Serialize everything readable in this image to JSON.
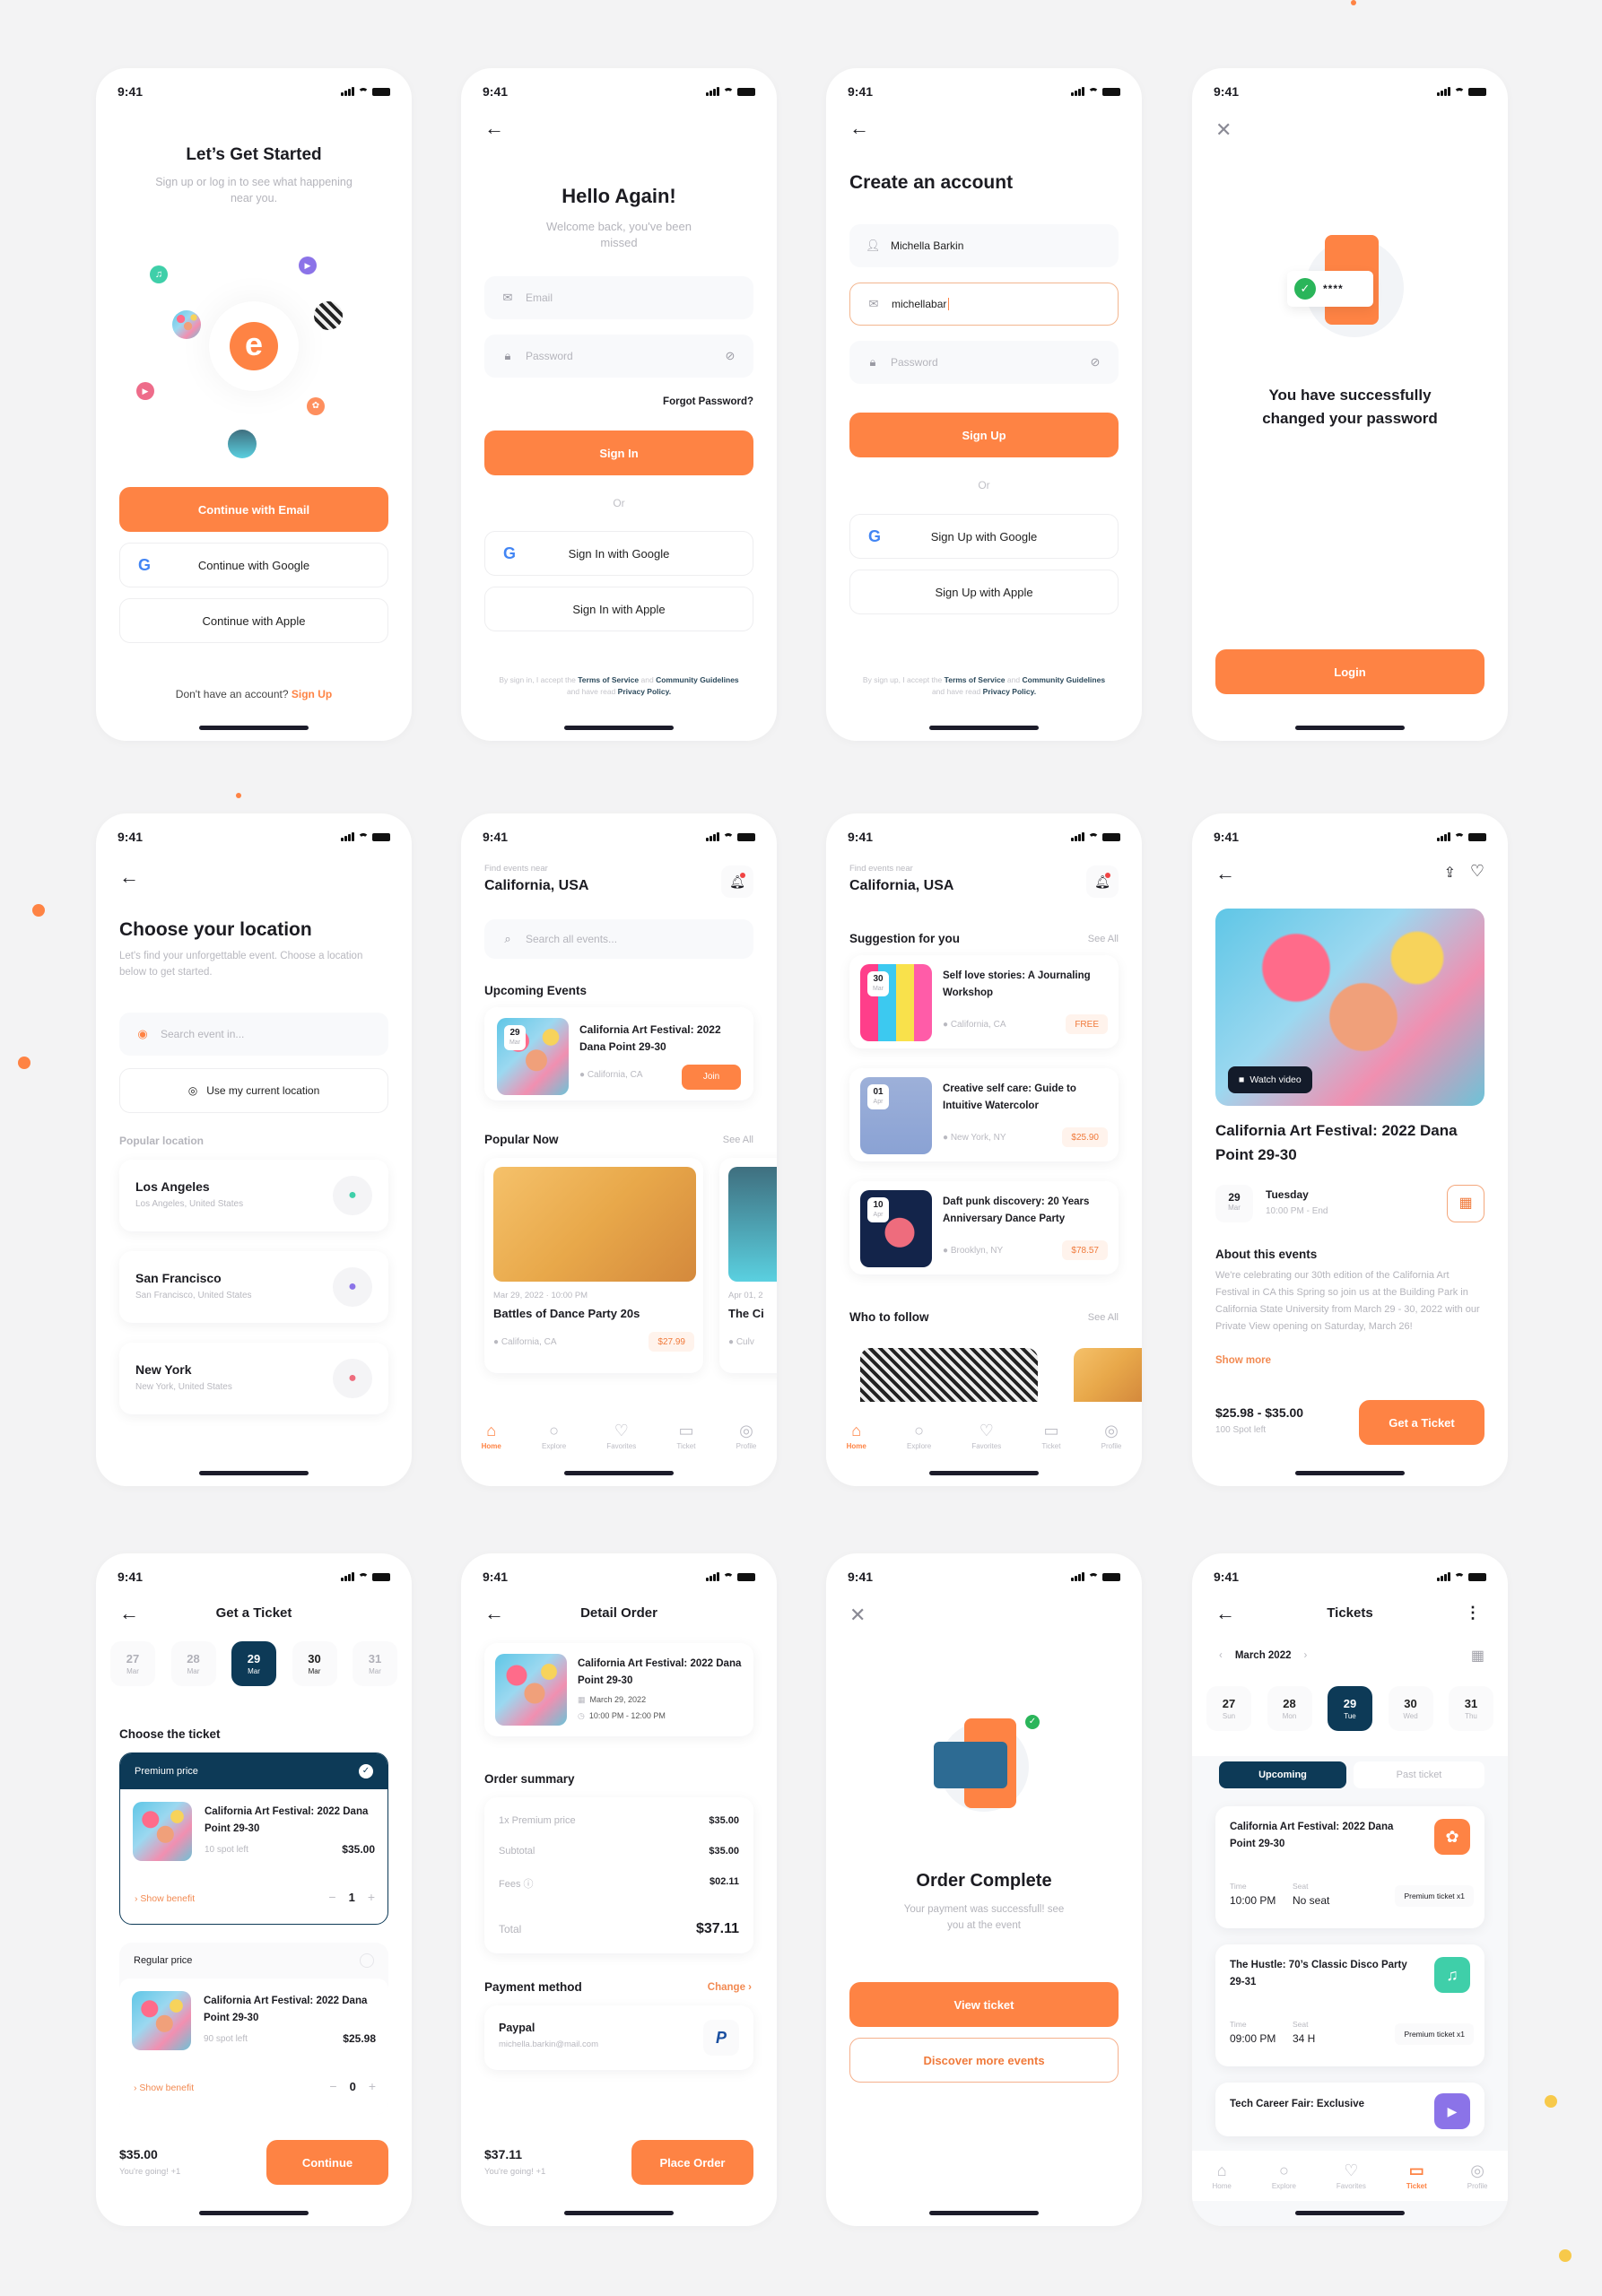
{
  "status_time": "9:41",
  "colors": {
    "accent": "#fe8344",
    "navy": "#0d3a57",
    "green": "#2dc58a",
    "purple": "#8b73e8",
    "pink": "#ee6c7d",
    "teal": "#3fcfa9"
  },
  "onboarding": {
    "title": "Let’s Get Started",
    "subtitle": "Sign up or log in to see what happening near you.",
    "logo_letter": "e",
    "email_btn": "Continue with Email",
    "google_btn": "Continue with Google",
    "apple_btn": "Continue with Apple",
    "footer_text": "Don't have an account?",
    "footer_link": "Sign Up"
  },
  "signin": {
    "title": "Hello Again!",
    "subtitle": "Welcome back, you've been missed",
    "email_placeholder": "Email",
    "password_placeholder": "Password",
    "forgot": "Forgot Password?",
    "submit": "Sign In",
    "or": "Or",
    "google_btn": "Sign In with Google",
    "apple_btn": "Sign In with Apple",
    "terms_pre": "By sign in, I accept the",
    "terms_tos": "Terms of Service",
    "terms_and": "and",
    "terms_cg": "Community Guidelines",
    "terms_mid": "and have read",
    "terms_pp": "Privacy Policy."
  },
  "signup": {
    "title": "Create an account",
    "name_value": "Michella Barkin",
    "email_value": "michellabar",
    "password_placeholder": "Password",
    "submit": "Sign Up",
    "or": "Or",
    "google_btn": "Sign Up with Google",
    "apple_btn": "Sign Up with Apple",
    "terms_pre": "By sign up, I accept the",
    "terms_tos": "Terms of Service",
    "terms_and": "and",
    "terms_cg": "Community Guidelines",
    "terms_mid": "and have read",
    "terms_pp": "Privacy Policy."
  },
  "pw_success": {
    "mask": "****",
    "message": "You have successfully changed your password",
    "button": "Login"
  },
  "location": {
    "title": "Choose your location",
    "subtitle": "Let's find your unforgettable event. Choose a location below to get started.",
    "search_placeholder": "Search event in...",
    "current_btn": "Use my current location",
    "section": "Popular location",
    "items": [
      {
        "name": "Los Angeles",
        "detail": "Los Angeles, United States"
      },
      {
        "name": "San Francisco",
        "detail": "San Francisco, United States"
      },
      {
        "name": "New York",
        "detail": "New York, United States"
      }
    ]
  },
  "home": {
    "near_label": "Find events near",
    "location": "California, USA",
    "search_placeholder": "Search all events...",
    "upcoming_title": "Upcoming Events",
    "upcoming": {
      "day": "29",
      "month": "Mar",
      "title": "California Art Festival: 2022 Dana Point 29-30",
      "place": "California, CA",
      "join": "Join"
    },
    "popular_title": "Popular Now",
    "see_all": "See All",
    "popular": [
      {
        "date": "Mar 29, 2022",
        "time": "10:00 PM",
        "title": "Battles of Dance Party 20s",
        "place": "California, CA",
        "price": "$27.99"
      },
      {
        "date": "Apr 01, 2",
        "title": "The Ci",
        "place": "Culv"
      }
    ]
  },
  "nav": [
    {
      "label": "Home",
      "icon": "⌂"
    },
    {
      "label": "Explore",
      "icon": "○"
    },
    {
      "label": "Favorites",
      "icon": "♡"
    },
    {
      "label": "Ticket",
      "icon": "▭"
    },
    {
      "label": "Profile",
      "icon": "◎"
    }
  ],
  "home2": {
    "near_label": "Find events near",
    "location": "California, USA",
    "suggest_title": "Suggestion for you",
    "see_all": "See All",
    "suggestions": [
      {
        "day": "30",
        "month": "Mar",
        "title": "Self love stories: A Journaling Workshop",
        "place": "California, CA",
        "price": "FREE"
      },
      {
        "day": "01",
        "month": "Apr",
        "title": "Creative self care: Guide to Intuitive Watercolor",
        "place": "New York, NY",
        "price": "$25.90"
      },
      {
        "day": "10",
        "month": "Apr",
        "title": "Daft punk discovery: 20 Years Anniversary Dance Party",
        "place": "Brooklyn, NY",
        "price": "$78.57"
      }
    ],
    "follow_title": "Who to follow"
  },
  "detail": {
    "watch": "Watch video",
    "title": "California Art Festival: 2022 Dana Point 29-30",
    "day": "29",
    "month": "Mar",
    "weekday": "Tuesday",
    "time": "10:00 PM - End",
    "about_title": "About this events",
    "about": "We're celebrating our 30th edition of the California Art Festival in CA this Spring so join us at the Building Park in California State University from March 29 - 30, 2022 with our Private View opening on Saturday, March 26!",
    "show_more": "Show more",
    "price_range": "$25.98 - $35.00",
    "spots": "100 Spot left",
    "cta": "Get a Ticket"
  },
  "get_ticket": {
    "title": "Get a Ticket",
    "days": [
      {
        "d": "27",
        "m": "Mar"
      },
      {
        "d": "28",
        "m": "Mar"
      },
      {
        "d": "29",
        "m": "Mar"
      },
      {
        "d": "30",
        "m": "Mar"
      },
      {
        "d": "31",
        "m": "Mar"
      }
    ],
    "section": "Choose the ticket",
    "tickets": [
      {
        "tier": "Premium price",
        "title": "California Art Festival: 2022 Dana Point 29-30",
        "spots": "10 spot left",
        "price": "$35.00",
        "benefit": "Show benefit",
        "qty": "1",
        "selected": true
      },
      {
        "tier": "Regular price",
        "title": "California Art Festival: 2022 Dana Point 29-30",
        "spots": "90 spot left",
        "price": "$25.98",
        "benefit": "Show benefit",
        "qty": "0",
        "selected": false
      }
    ],
    "total": "$35.00",
    "going": "You're going! +1",
    "cta": "Continue"
  },
  "order": {
    "title": "Detail Order",
    "event_title": "California Art Festival: 2022 Dana Point 29-30",
    "date": "March 29, 2022",
    "time": "10:00 PM - 12:00 PM",
    "summary_title": "Order summary",
    "lines": [
      {
        "k": "1x Premium price",
        "v": "$35.00"
      },
      {
        "k": "Subtotal",
        "v": "$35.00"
      },
      {
        "k": "Fees",
        "v": "$02.11"
      }
    ],
    "total_label": "Total",
    "total": "$37.11",
    "payment_title": "Payment method",
    "change": "Change",
    "method": "Paypal",
    "email": "michella.barkin@mail.com",
    "footer_total": "$37.11",
    "going": "You're going! +1",
    "cta": "Place Order"
  },
  "complete": {
    "title": "Order Complete",
    "subtitle": "Your payment was successfull! see you at the event",
    "view": "View ticket",
    "discover": "Discover more events"
  },
  "tickets": {
    "title": "Tickets",
    "month": "March 2022",
    "days": [
      {
        "d": "27",
        "w": "Sun"
      },
      {
        "d": "28",
        "w": "Mon"
      },
      {
        "d": "29",
        "w": "Tue"
      },
      {
        "d": "30",
        "w": "Wed"
      },
      {
        "d": "31",
        "w": "Thu"
      }
    ],
    "tab_upcoming": "Upcoming",
    "tab_past": "Past ticket",
    "time_label": "Time",
    "seat_label": "Seat",
    "items": [
      {
        "title": "California Art Festival: 2022 Dana Point 29-30",
        "time": "10:00 PM",
        "seat": "No seat",
        "type": "Premium ticket x1",
        "icon": "palette-icon"
      },
      {
        "title": "The Hustle: 70’s Classic Disco Party 29-31",
        "time": "09:00 PM",
        "seat": "34 H",
        "type": "Premium ticket x1",
        "icon": "music-icon"
      },
      {
        "title": "Tech Career Fair: Exclusive",
        "icon": "video-icon"
      }
    ]
  }
}
